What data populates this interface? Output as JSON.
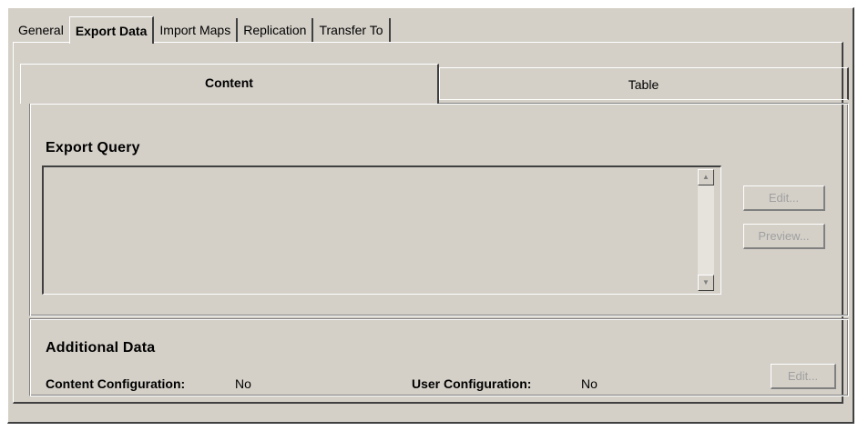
{
  "outer_tabs": [
    {
      "label": "General"
    },
    {
      "label": "Export Data"
    },
    {
      "label": "Import Maps"
    },
    {
      "label": "Replication"
    },
    {
      "label": "Transfer To"
    }
  ],
  "selected_outer_tab": "Export Data",
  "inner_tabs": [
    {
      "label": "Content"
    },
    {
      "label": "Table"
    }
  ],
  "selected_inner_tab": "Content",
  "export_query": {
    "title": "Export Query",
    "value": "",
    "edit_label": "Edit...",
    "preview_label": "Preview...",
    "scroll_up_icon": "arrow-up-icon",
    "scroll_down_icon": "arrow-down-icon"
  },
  "additional_data": {
    "title": "Additional Data",
    "content_config_label": "Content Configuration:",
    "content_config_value": "No",
    "user_config_label": "User Configuration:",
    "user_config_value": "No",
    "edit_label": "Edit..."
  },
  "colors": {
    "background": "#d4d0c8",
    "disabled_text": "#a0a0a0"
  }
}
